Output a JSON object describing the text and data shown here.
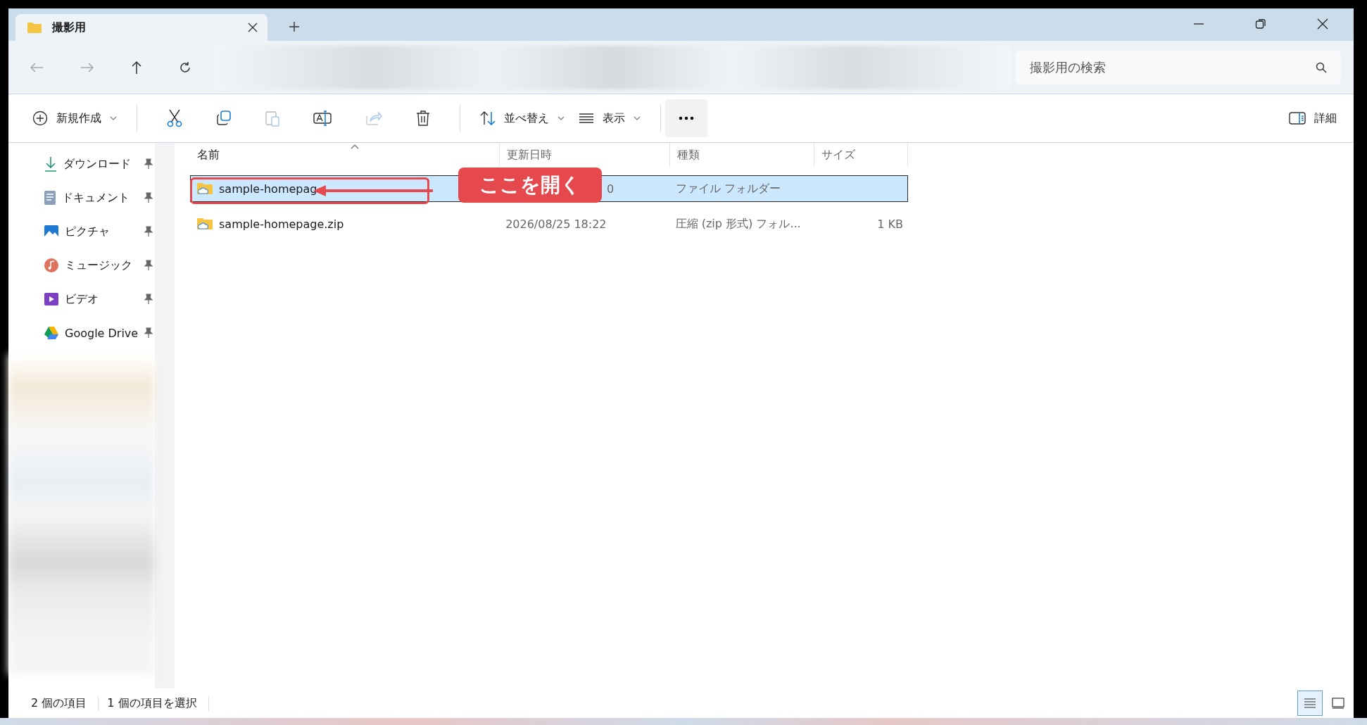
{
  "window": {
    "tab_title": "撮影用",
    "search": {
      "placeholder": "撮影用の検索"
    }
  },
  "toolbar": {
    "new_label": "新規作成",
    "sort_label": "並べ替え",
    "view_label": "表示",
    "details_label": "詳細"
  },
  "sidebar": {
    "items": [
      {
        "label": "ダウンロード",
        "kind": "download",
        "pinned": true
      },
      {
        "label": "ドキュメント",
        "kind": "document",
        "pinned": true
      },
      {
        "label": "ピクチャ",
        "kind": "picture",
        "pinned": true
      },
      {
        "label": "ミュージック",
        "kind": "music",
        "pinned": true
      },
      {
        "label": "ビデオ",
        "kind": "video",
        "pinned": true
      },
      {
        "label": "Google Drive",
        "kind": "drive",
        "pinned": true
      }
    ]
  },
  "columns": [
    {
      "label": "名前",
      "sorted": true
    },
    {
      "label": "更新日時",
      "sorted": false
    },
    {
      "label": "種類",
      "sorted": false
    },
    {
      "label": "サイズ",
      "sorted": false
    }
  ],
  "rows": [
    {
      "name": "sample-homepag",
      "date": "0",
      "type": "ファイル フォルダー",
      "selected": true
    },
    {
      "name": "sample-homepage.zip",
      "date": "2026/08/25 18:22",
      "type": "圧縮 (zip 形式) フォル...",
      "size": "1 KB",
      "selected": false
    }
  ],
  "status": {
    "count": "2 個の項目",
    "selection": "1 個の項目を選択"
  },
  "view_modes": [
    {
      "kind": "details",
      "selected": true
    },
    {
      "kind": "tiles",
      "selected": false
    }
  ],
  "annotation": {
    "text": "ここを開く"
  }
}
